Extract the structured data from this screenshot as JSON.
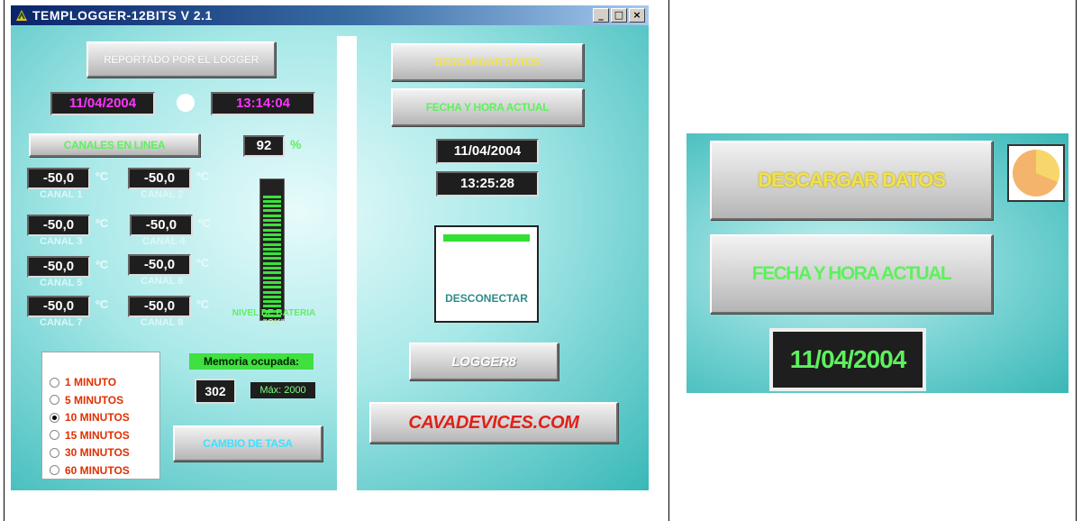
{
  "window": {
    "title": "TEMPLOGGER-12BITS V 2.1",
    "minimize": "_",
    "maximize": "□",
    "close": "×"
  },
  "left": {
    "reported_button": "REPORTADO POR EL LOGGER",
    "logger_date": "11/04/2004",
    "logger_time": "13:14:04",
    "channels_button": "CANALES EN LINEA",
    "battery_percent": "92",
    "percent_sign": "%",
    "battery_level_fraction": 0.92,
    "battery_label_line1": "NIVEL DE BATERIA",
    "battery_label_line2": "\"OK\"",
    "degree_unit": "ºC",
    "channels": [
      {
        "value": "-50,0",
        "label": "CANAL 1"
      },
      {
        "value": "-50,0",
        "label": "CANAL 2"
      },
      {
        "value": "-50,0",
        "label": "CANAL 3"
      },
      {
        "value": "-50,0",
        "label": "CANAL 4"
      },
      {
        "value": "-50,0",
        "label": "CANAL 5"
      },
      {
        "value": "-50,0",
        "label": "CANAL 6"
      },
      {
        "value": "-50,0",
        "label": "CANAL 7"
      },
      {
        "value": "-50,0",
        "label": "CANAL 8"
      }
    ],
    "rates": [
      {
        "label": "1 MINUTO",
        "selected": false
      },
      {
        "label": "5 MINUTOS",
        "selected": false
      },
      {
        "label": "10 MINUTOS",
        "selected": true
      },
      {
        "label": "15 MINUTOS",
        "selected": false
      },
      {
        "label": "30 MINUTOS",
        "selected": false
      },
      {
        "label": "60 MINUTOS",
        "selected": false
      }
    ],
    "memory_label": "Memoria ocupada:",
    "memory_value": "302",
    "memory_max": "Máx: 2000",
    "rate_change_button": "CAMBIO DE TASA"
  },
  "right": {
    "download_button": "DESCARGAR DATOS",
    "current_datetime_button": "FECHA Y HORA ACTUAL",
    "current_date": "11/04/2004",
    "current_time": "13:25:28",
    "disconnect_button": "DESCONECTAR",
    "logger_button": "LOGGER8",
    "website_button": "CAVADEVICES.COM"
  },
  "zoom": {
    "download_button": "DESCARGAR DATOS",
    "current_datetime_button": "FECHA Y HORA ACTUAL",
    "date": "11/04/2004"
  },
  "colors": {
    "teal": "#39b8b8",
    "lcd_magenta": "#ff33ff",
    "lcd_green": "#7dff7d",
    "link_red": "#e0201a",
    "yellow_text": "#f2e24a",
    "green_text": "#5ef05e"
  }
}
